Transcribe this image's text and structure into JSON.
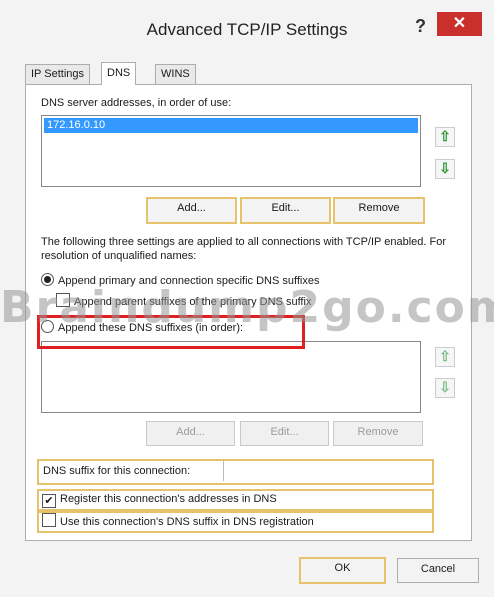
{
  "window": {
    "title": "Advanced TCP/IP Settings",
    "help_glyph": "?",
    "close_glyph": "✕",
    "close_color": "#c9302c"
  },
  "tabs": [
    {
      "label": "IP Settings"
    },
    {
      "label": "DNS"
    },
    {
      "label": "WINS"
    }
  ],
  "dns_servers": {
    "label": "DNS server addresses, in order of use:",
    "items": [
      "172.16.0.10"
    ],
    "add_label": "Add...",
    "edit_label": "Edit...",
    "remove_label": "Remove"
  },
  "settings_note": "The following three settings are applied to all connections with TCP/IP enabled. For resolution of unqualified names:",
  "radios": {
    "primary": "Append primary and connection specific DNS suffixes",
    "parent": "Append parent suffixes of the primary DNS suffix",
    "these": "Append these DNS suffixes (in order):"
  },
  "suffixes": {
    "items": [],
    "add_label": "Add...",
    "edit_label": "Edit...",
    "remove_label": "Remove"
  },
  "suffix_connection_label": "DNS suffix for this connection:",
  "checkboxes": {
    "register": {
      "label": "Register this connection's addresses in DNS",
      "checked": true
    },
    "use_suffix": {
      "label": "Use this connection's DNS suffix in DNS registration",
      "checked": false
    }
  },
  "footer": {
    "ok_label": "OK",
    "cancel_label": "Cancel"
  },
  "watermark": "Braindump2go.com",
  "arrow_icons": {
    "up": "⇧",
    "down": "⇩"
  }
}
